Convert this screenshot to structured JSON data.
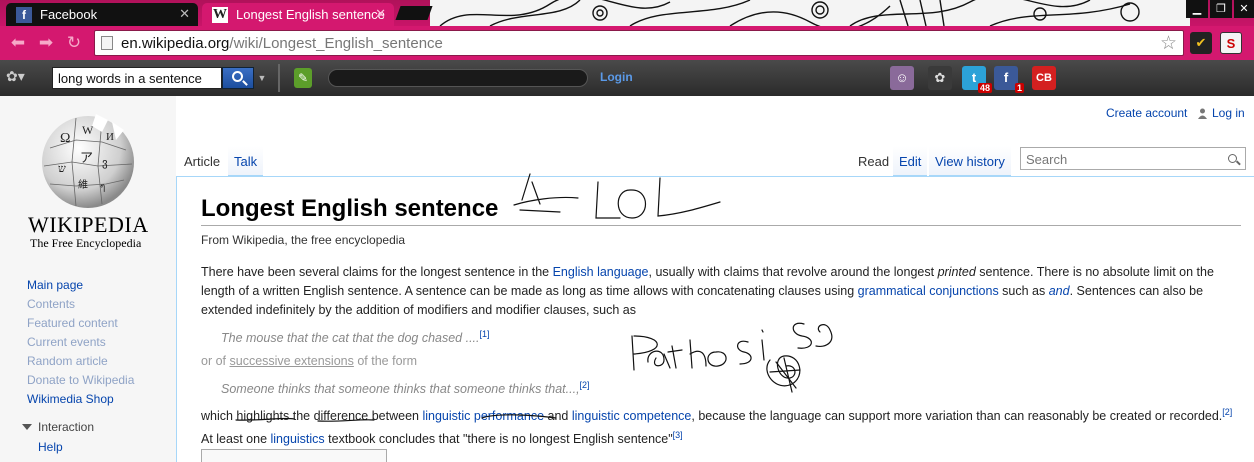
{
  "browser": {
    "tabs": [
      {
        "label": "Facebook",
        "favicon": "f",
        "active": false
      },
      {
        "label": "Longest English sentence",
        "favicon": "W",
        "active": true
      }
    ],
    "url_host": "en.wikipedia.org",
    "url_path": "/wiki/Longest_English_sentence",
    "accent": "#d4186f"
  },
  "toolbar": {
    "search_value": "long words in a sentence",
    "login_label": "Login",
    "fb_badge": "1",
    "twitter_badge": "48",
    "cb_label": "CB"
  },
  "wiki": {
    "logo_word": "WIKIPEDIA",
    "logo_tagline": "The Free Encyclopedia",
    "create_account": "Create account",
    "log_in": "Log in",
    "nav": [
      "Main page",
      "Contents",
      "Featured content",
      "Current events",
      "Random article",
      "Donate to Wikipedia",
      "Wikimedia Shop"
    ],
    "interaction_label": "Interaction",
    "help_label": "Help",
    "tabs_left": [
      "Article",
      "Talk"
    ],
    "tabs_right": [
      "Read",
      "Edit",
      "View history"
    ],
    "search_placeholder": "Search",
    "title": "Longest English sentence",
    "tagline": "From Wikipedia, the free encyclopedia",
    "p1": {
      "t1": "There have been several claims for the longest sentence in the ",
      "l1": "English language",
      "t2": ", usually with claims that revolve around the longest ",
      "em": "printed",
      "t3": " sentence. There is no absolute limit on the length of a written English sentence. A sentence can be made as long as time allows with concatenating clauses using ",
      "l2": "grammatical conjunctions",
      "t4": " such as ",
      "l3": "and",
      "t5": ". Sentences can also be extended indefinitely by the addition of modifiers and modifier clauses, such as"
    },
    "quote1": "The mouse that the cat that the dog chased ....",
    "ref1": "[1]",
    "p2": {
      "t1": "or of ",
      "u": "successive extensions",
      "t2": " of the form"
    },
    "quote2": "Someone thinks that someone thinks that someone thinks that...,",
    "ref2": "[2]",
    "p3": {
      "t1": "which highlights the difference between ",
      "l1": "linguistic performance",
      "t2": " and ",
      "l2": "linguistic competence",
      "t3": ", because the language can support more variation than can reasonably be created or recorded.",
      "ref2": "[2]",
      "t4": " At least one ",
      "l3": "linguistics",
      "t5": " textbook concludes that \"there is no longest English sentence\"",
      "ref3": "[3]"
    }
  }
}
